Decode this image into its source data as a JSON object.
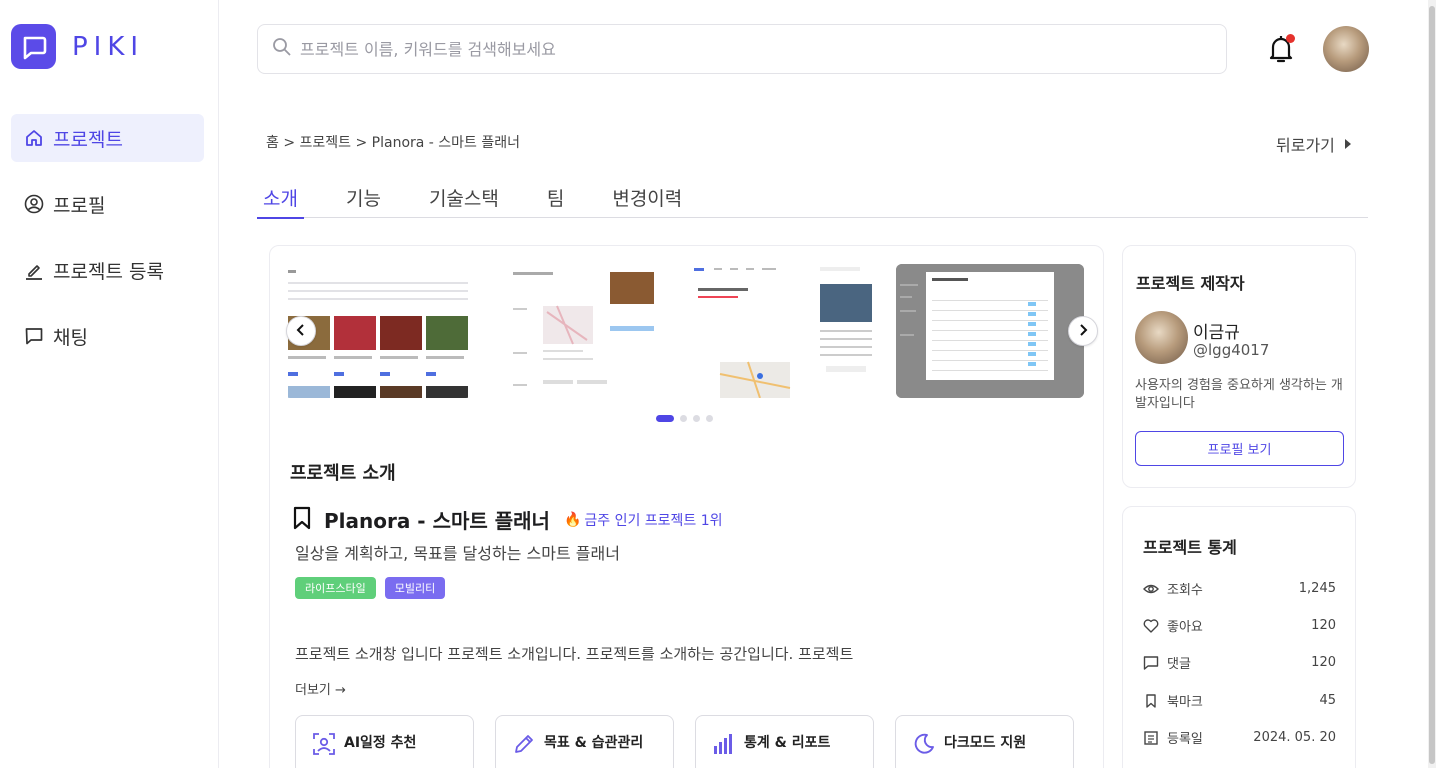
{
  "brand": {
    "name": "PIKI",
    "accent": "#4f46e5"
  },
  "sidebar": {
    "items": [
      {
        "label": "프로젝트",
        "icon": "home-icon",
        "active": true
      },
      {
        "label": "프로필",
        "icon": "user-circle-icon",
        "active": false
      },
      {
        "label": "프로젝트 등록",
        "icon": "edit-icon",
        "active": false
      },
      {
        "label": "채팅",
        "icon": "chat-icon",
        "active": false
      }
    ]
  },
  "header": {
    "search_placeholder": "프로젝트 이름, 키워드를 검색해보세요",
    "notification_unread": true
  },
  "breadcrumb": "홈 > 프로젝트 > Planora - 스마트 플래너",
  "back_label": "뒤로가기",
  "tabs": [
    {
      "label": "소개",
      "active": true
    },
    {
      "label": "기능",
      "active": false
    },
    {
      "label": "기술스택",
      "active": false
    },
    {
      "label": "팀",
      "active": false
    },
    {
      "label": "변경이력",
      "active": false
    }
  ],
  "carousel": {
    "slide_count": 4,
    "active_index": 0
  },
  "intro": {
    "heading": "프로젝트 소개",
    "title": "Planora - 스마트 플래너",
    "hot_label": "금주 인기 프로젝트 1위",
    "subtitle": "일상을 계획하고, 목표를 달성하는 스마트 플래너",
    "tags": [
      {
        "label": "라이프스타일",
        "color": "#5fcf7a"
      },
      {
        "label": "모빌리티",
        "color": "#7a6cf0"
      }
    ],
    "description": "프로젝트 소개창 입니다 프로젝트 소개입니다. 프로젝트를 소개하는 공간입니다. 프로젝트",
    "more_label": "더보기 →",
    "features": [
      {
        "label": "AI일정 추천",
        "icon": "ai-person-icon"
      },
      {
        "label": "목표 & 습관관리",
        "icon": "pencil-icon"
      },
      {
        "label": "통계 & 리포트",
        "icon": "bar-chart-icon"
      },
      {
        "label": "다크모드 지원",
        "icon": "moon-icon"
      }
    ]
  },
  "maker": {
    "heading": "프로젝트 제작자",
    "name": "이금규",
    "handle": "@lgg4017",
    "bio": "사용자의 경험을 중요하게 생각하는 개발자입니다",
    "button_label": "프로필 보기"
  },
  "stats": {
    "heading": "프로젝트 통계",
    "rows": [
      {
        "label": "조회수",
        "value": "1,245",
        "icon": "eye-icon"
      },
      {
        "label": "좋아요",
        "value": "120",
        "icon": "heart-icon"
      },
      {
        "label": "댓글",
        "value": "120",
        "icon": "comment-icon"
      },
      {
        "label": "북마크",
        "value": "45",
        "icon": "bookmark-icon"
      },
      {
        "label": "등록일",
        "value": "2024. 05. 20",
        "icon": "calendar-icon"
      }
    ]
  }
}
